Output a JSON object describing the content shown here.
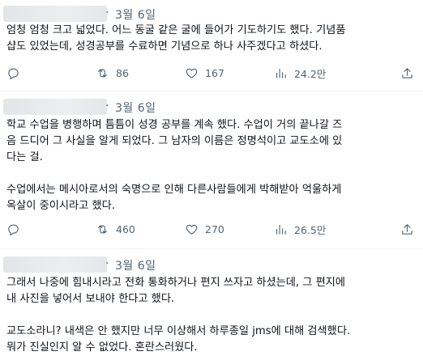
{
  "tweets": [
    {
      "date": "3월 6일",
      "text": "엄청 엄청 크고 넓었다. 어느 동굴 같은 굴에 들어가 기도하기도 했다. 기념품\n샵도 있었는데, 성경공부를 수료하면 기념으로 하나 사주겠다고 하셨다.",
      "replies": "",
      "retweets": "86",
      "likes": "167",
      "views": "24.2만"
    },
    {
      "date": "3월 6일",
      "text": "학교 수업을 병행하며 틈틈이 성경 공부를 계속 했다. 수업이 거의 끝나갈 즈\n음 드디어 그 사실을 알게 되었다. 그 남자의 이름은 정명석이고 교도소에 있\n다는 걸.\n\n수업에서는 메시아로서의 숙명으로 인해 다른사람들에게 박해받아 억울하게\n옥살이 중이시라고 했다.",
      "replies": "",
      "retweets": "460",
      "likes": "270",
      "views": "26.5만"
    },
    {
      "date": "3월 6일",
      "text": "그래서 나중에 힘내시라고 전화 통화하거나 편지 쓰자고 하셨는데, 그 편지에\n내 사진을 넣어서 보내야 한다고 했다.\n\n교도소라니? 내색은 안 했지만 너무 이상해서 하루종일 jms에 대해 검색했다.\n뭐가 진실인지 알 수 없었다. 혼란스러웠다."
    }
  ],
  "icons": {
    "reply": "reply-icon",
    "retweet": "retweet-icon",
    "like": "heart-icon",
    "views": "views-icon",
    "share": "share-icon"
  },
  "colors": {
    "text": "#0f1419",
    "muted": "#536471",
    "separator": "#eff3f4"
  }
}
